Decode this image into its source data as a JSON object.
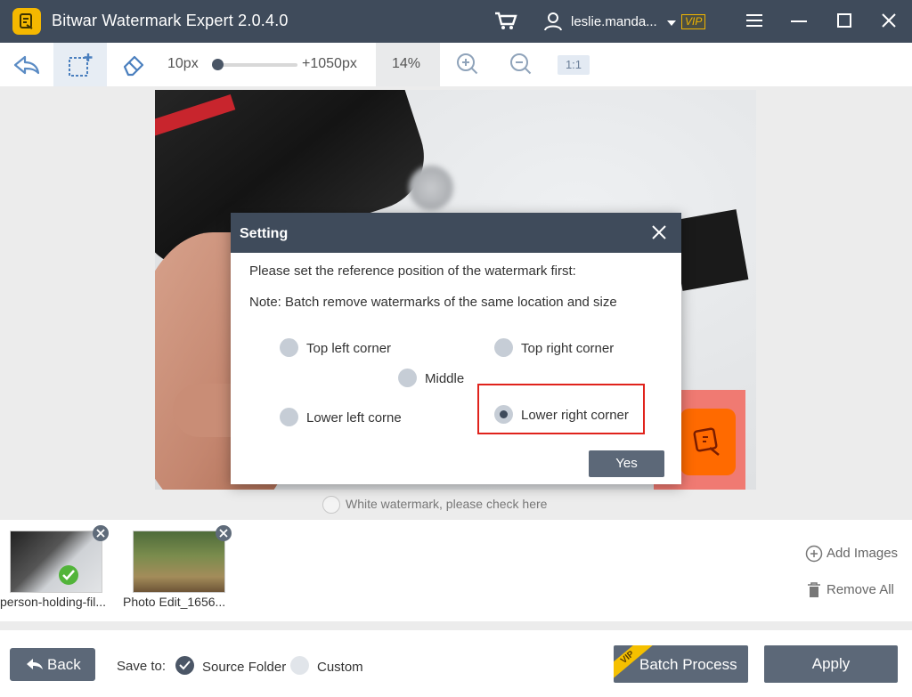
{
  "app": {
    "title": "Bitwar Watermark Expert  2.0.4.0",
    "username": "leslie.manda...",
    "vip_label": "VIP"
  },
  "toolbar": {
    "brush_min": "10px",
    "brush_max": "+1050px",
    "brush_level": 0.0,
    "zoom": "14%",
    "ratio_label": "1:1"
  },
  "canvas": {
    "white_watermark_label": "White watermark, please check here"
  },
  "dialog": {
    "title": "Setting",
    "line1": "Please set the reference position of the watermark first:",
    "line2": "Note: Batch remove watermarks of the same location and size",
    "options": {
      "top_left": "Top left corner",
      "top_right": "Top right corner",
      "middle": "Middle",
      "lower_left": "Lower left corne",
      "lower_right": "Lower right corner"
    },
    "selected": "lower_right",
    "yes_label": "Yes"
  },
  "thumbnails": [
    {
      "name": "person-holding-fil...",
      "processed": true
    },
    {
      "name": "Photo Edit_1656...",
      "processed": false
    }
  ],
  "side_actions": {
    "add_images": "Add Images",
    "remove_all": "Remove All"
  },
  "footer": {
    "back_label": "Back",
    "save_to_label": "Save to:",
    "source_folder": "Source Folder",
    "custom": "Custom",
    "save_selected": "source_folder",
    "batch_label": "Batch Process",
    "batch_vip": "VIP",
    "apply_label": "Apply"
  },
  "colors": {
    "titlebar": "#3f4b5b",
    "button": "#5c6878",
    "accent_yellow": "#f5b800",
    "highlight_red": "#e0231c"
  }
}
